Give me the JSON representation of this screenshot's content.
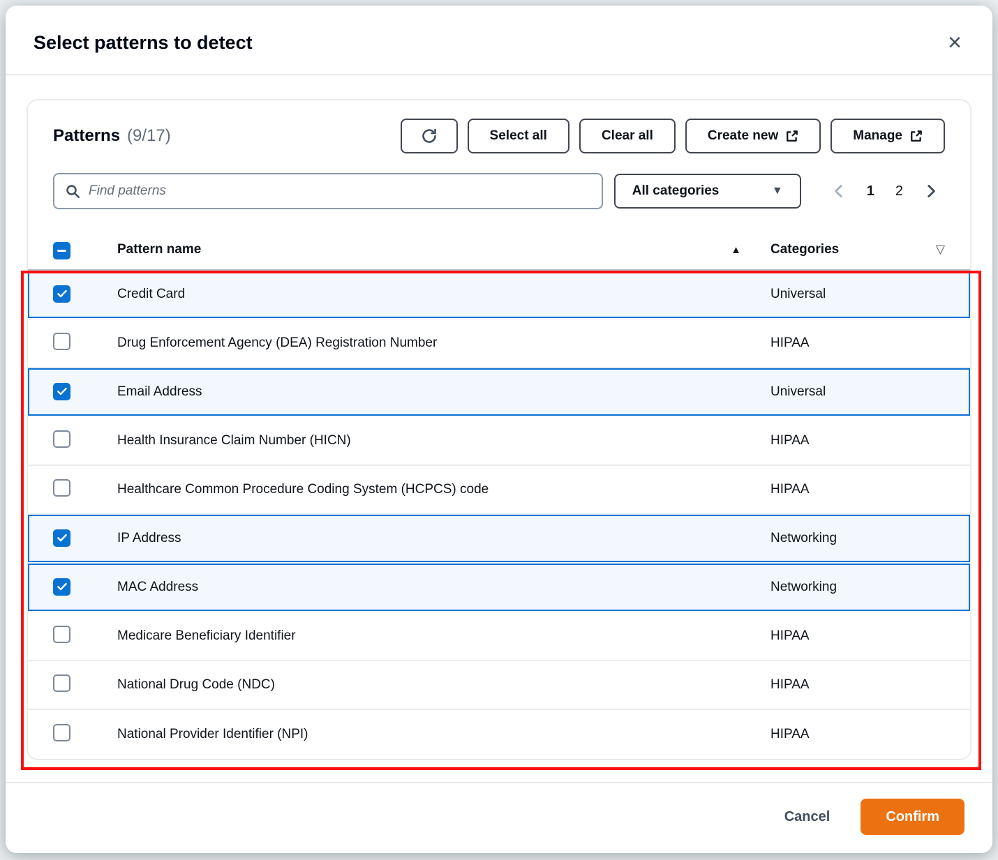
{
  "modal": {
    "title": "Select patterns to detect",
    "close_glyph": "×"
  },
  "toolbar": {
    "title": "Patterns",
    "counter": "(9/17)",
    "select_all_label": "Select all",
    "clear_all_label": "Clear all",
    "create_new_label": "Create new",
    "manage_label": "Manage"
  },
  "filters": {
    "search_placeholder": "Find patterns",
    "category_dropdown_label": "All categories"
  },
  "pagination": {
    "current_page": "1",
    "pages": [
      "1",
      "2"
    ]
  },
  "table": {
    "header": {
      "name_column": "Pattern name",
      "categories_column": "Categories",
      "select_all_state": "indeterminate"
    },
    "rows": [
      {
        "name": "Credit Card",
        "category": "Universal",
        "checked": true
      },
      {
        "name": "Drug Enforcement Agency (DEA) Registration Number",
        "category": "HIPAA",
        "checked": false
      },
      {
        "name": "Email Address",
        "category": "Universal",
        "checked": true
      },
      {
        "name": "Health Insurance Claim Number (HICN)",
        "category": "HIPAA",
        "checked": false
      },
      {
        "name": "Healthcare Common Procedure Coding System (HCPCS) code",
        "category": "HIPAA",
        "checked": false
      },
      {
        "name": "IP Address",
        "category": "Networking",
        "checked": true
      },
      {
        "name": "MAC Address",
        "category": "Networking",
        "checked": true
      },
      {
        "name": "Medicare Beneficiary Identifier",
        "category": "HIPAA",
        "checked": false
      },
      {
        "name": "National Drug Code (NDC)",
        "category": "HIPAA",
        "checked": false
      },
      {
        "name": "National Provider Identifier (NPI)",
        "category": "HIPAA",
        "checked": false
      }
    ]
  },
  "footer": {
    "cancel_label": "Cancel",
    "confirm_label": "Confirm"
  },
  "glyphs": {
    "caret_down": "▼",
    "sort_ascending": "▲",
    "filter": "▽"
  },
  "colors": {
    "accent_blue": "#0972d3",
    "selected_row_bg": "#f2f8fd",
    "confirm_orange": "#ec7211",
    "annotation_red": "#fa0f0f"
  }
}
